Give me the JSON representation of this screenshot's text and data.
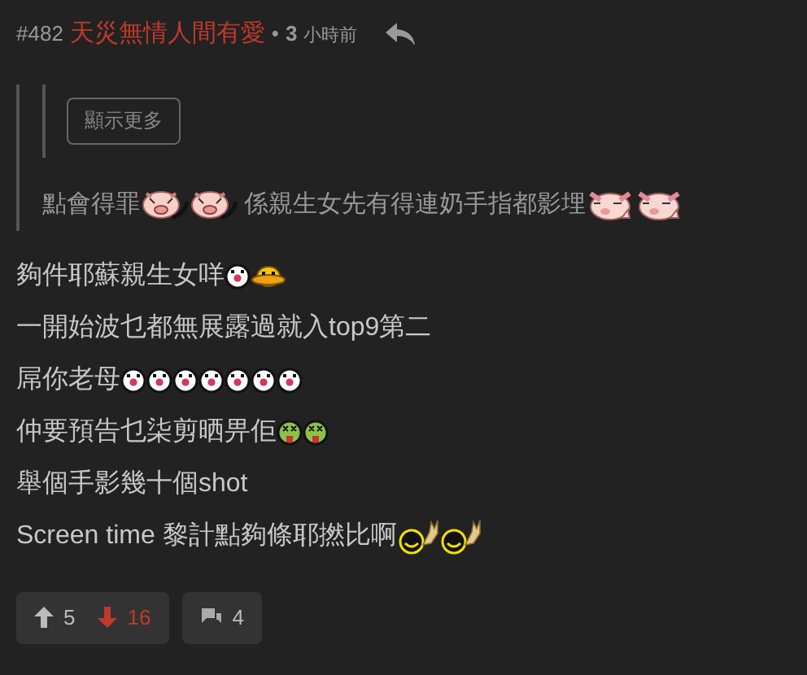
{
  "post": {
    "number": "#482",
    "author": "天災無情人間有愛",
    "separator": "•",
    "time_value": "3",
    "time_unit": "小時前"
  },
  "quote": {
    "show_more_button": "顯示更多",
    "segments": [
      {
        "kind": "text",
        "text": "點會得罪"
      },
      {
        "kind": "pig"
      },
      {
        "kind": "pig"
      },
      {
        "kind": "text",
        "text": " 係親生女先有得連奶手指都影埋"
      },
      {
        "kind": "pigface"
      },
      {
        "kind": "pigface"
      }
    ]
  },
  "lines": [
    [
      {
        "kind": "text",
        "text": "夠件耶蘇親生女咩"
      },
      {
        "kind": "clown"
      },
      {
        "kind": "duck"
      }
    ],
    [
      {
        "kind": "text",
        "text": "一開始波乜都無展露過就入top9第二"
      }
    ],
    [
      {
        "kind": "text",
        "text": "屌你老母"
      },
      {
        "kind": "clown"
      },
      {
        "kind": "clown"
      },
      {
        "kind": "clown"
      },
      {
        "kind": "clown"
      },
      {
        "kind": "clown"
      },
      {
        "kind": "clown"
      },
      {
        "kind": "clown"
      }
    ],
    [
      {
        "kind": "text",
        "text": "仲要預告乜柒剪晒畀佢"
      },
      {
        "kind": "sick"
      },
      {
        "kind": "sick"
      }
    ],
    [
      {
        "kind": "text",
        "text": "舉個手影幾十個shot"
      }
    ],
    [
      {
        "kind": "text",
        "text": "Screen time 黎計點夠條耶撚比啊"
      },
      {
        "kind": "rock"
      },
      {
        "kind": "rock"
      }
    ]
  ],
  "footer": {
    "upvotes": "5",
    "downvotes": "16",
    "replies": "4"
  }
}
